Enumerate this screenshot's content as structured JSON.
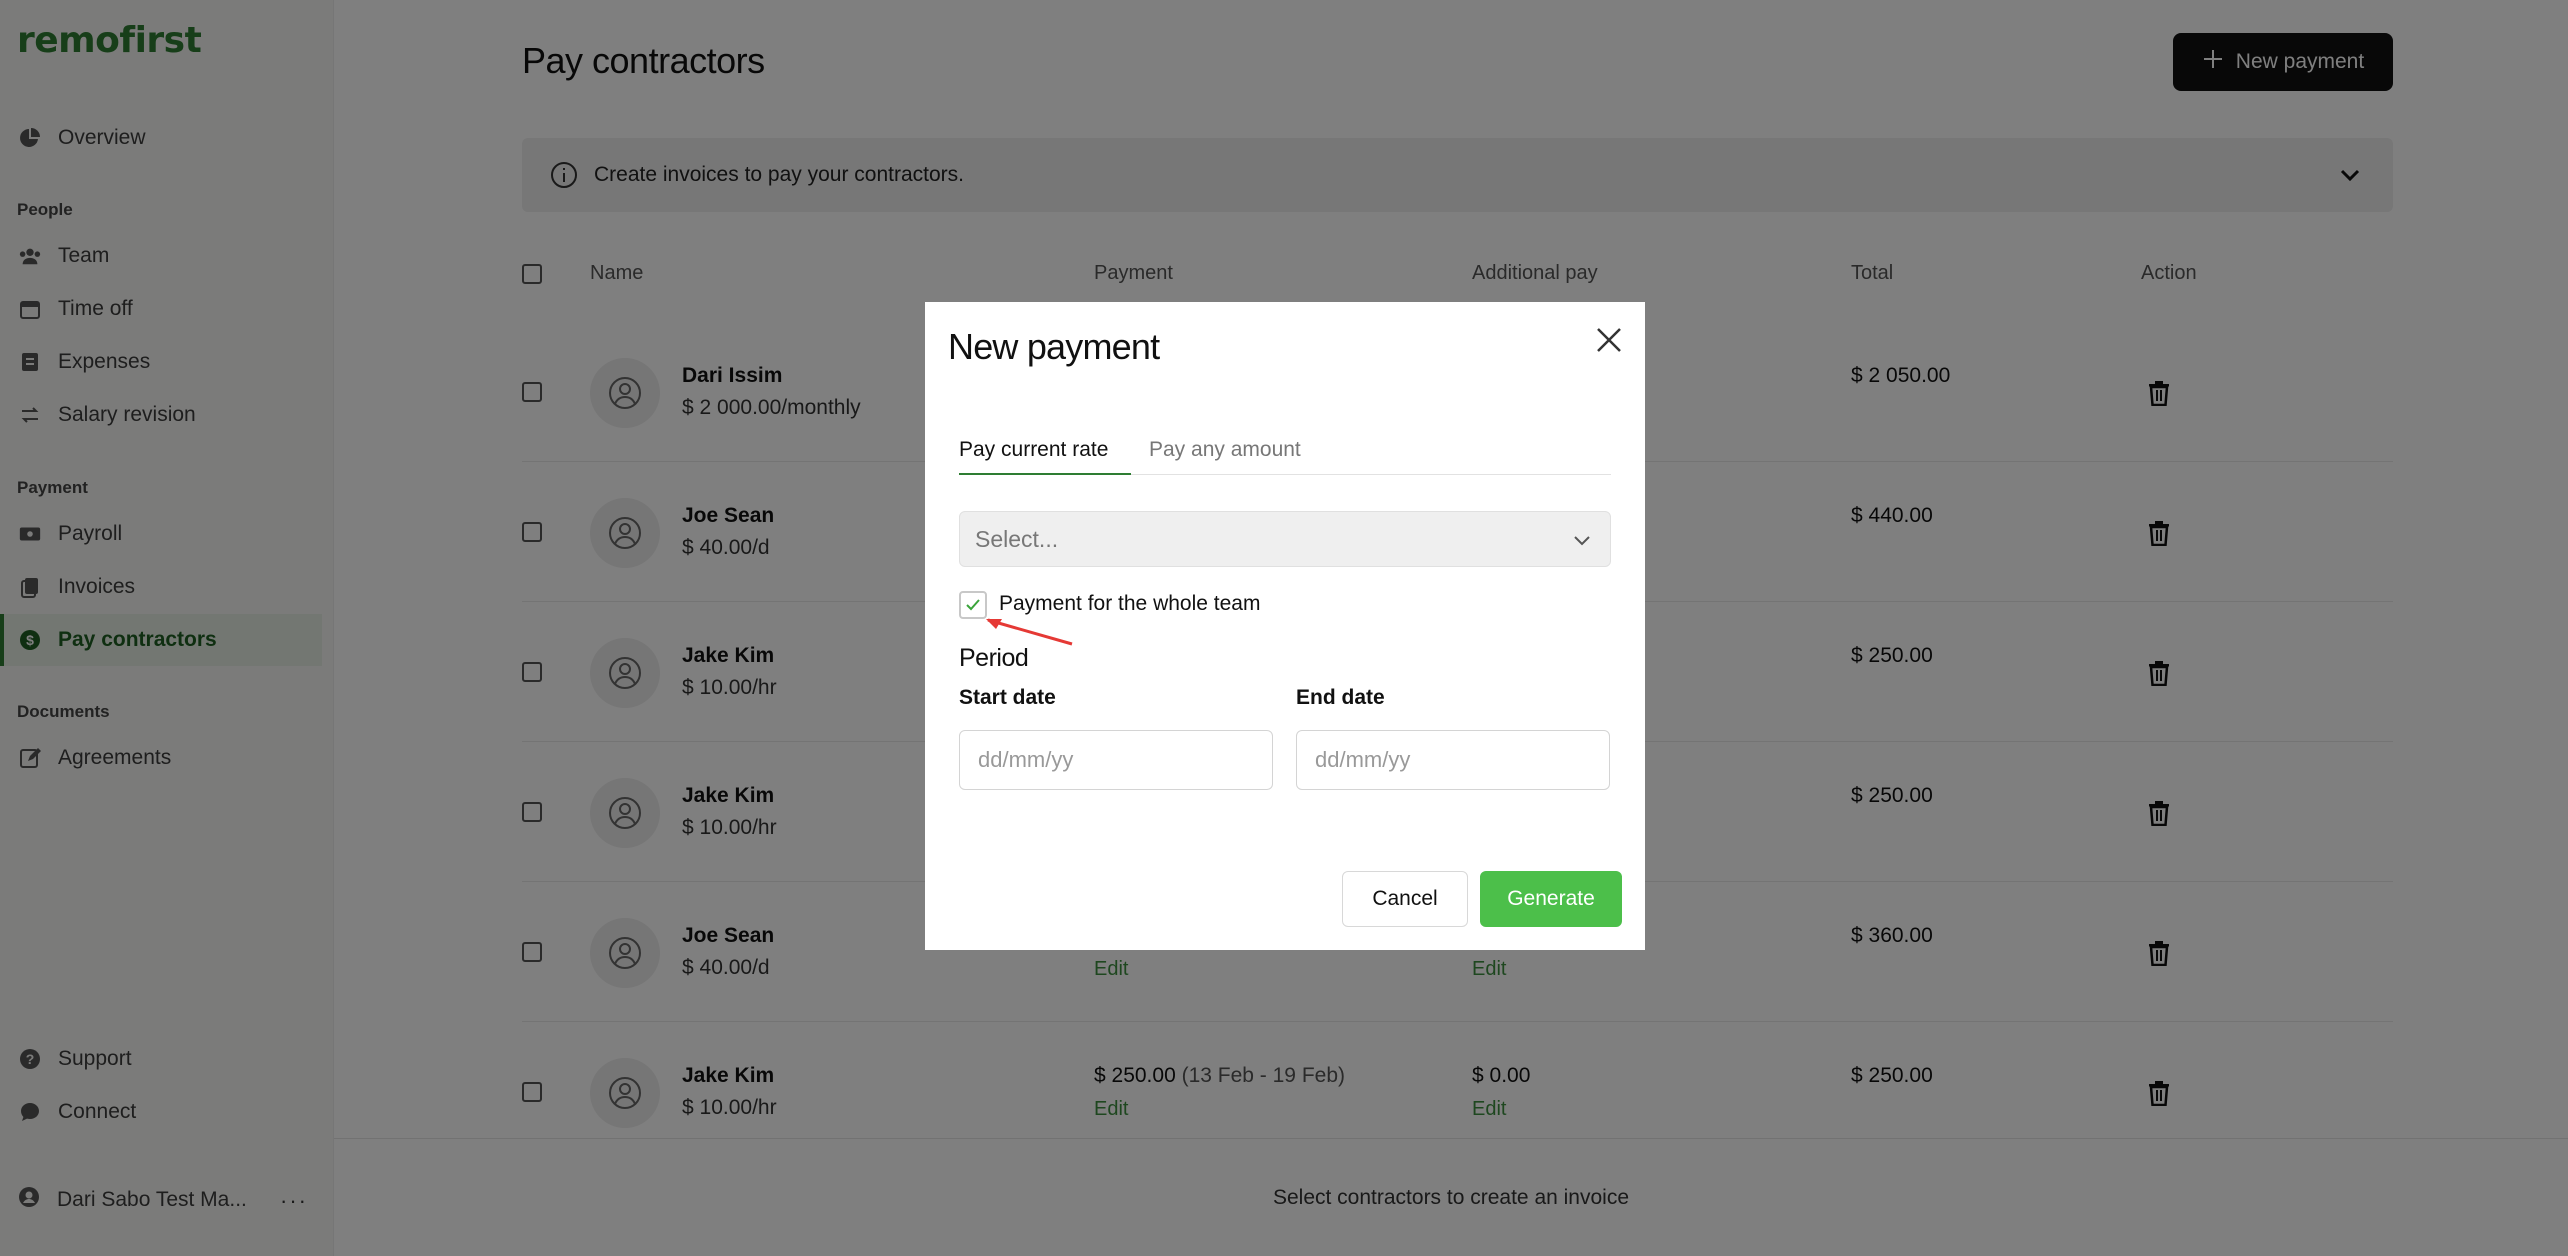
{
  "app": {
    "logo": "remofirst"
  },
  "sidebar": {
    "overview": "Overview",
    "sections": {
      "people": "People",
      "payment": "Payment",
      "documents": "Documents"
    },
    "people_items": [
      "Team",
      "Time off",
      "Expenses",
      "Salary revision"
    ],
    "payment_items": [
      "Payroll",
      "Invoices",
      "Pay contractors"
    ],
    "documents_items": [
      "Agreements"
    ],
    "bottom_items": [
      "Support",
      "Connect"
    ],
    "user": "Dari Sabo Test Ma...",
    "user_more": "···"
  },
  "header": {
    "title": "Pay contractors",
    "new_payment_label": "New payment",
    "banner_text": "Create invoices to pay your contractors."
  },
  "table": {
    "columns": [
      "Name",
      "Payment",
      "Additional pay",
      "Total",
      "Action"
    ],
    "edit_label": "Edit",
    "rows": [
      {
        "name": "Dari Issim",
        "rate": "$ 2 000.00/monthly",
        "payment": "",
        "period": "",
        "additional": "",
        "total": "$ 2 050.00"
      },
      {
        "name": "Joe Sean",
        "rate": "$ 40.00/d",
        "payment": "",
        "period": "",
        "additional": "",
        "total": "$ 440.00"
      },
      {
        "name": "Jake Kim",
        "rate": "$ 10.00/hr",
        "payment": "",
        "period": "",
        "additional": "",
        "total": "$ 250.00"
      },
      {
        "name": "Jake Kim",
        "rate": "$ 10.00/hr",
        "payment": "",
        "period": "",
        "additional": "",
        "total": "$ 250.00"
      },
      {
        "name": "Joe Sean",
        "rate": "$ 40.00/d",
        "payment": "",
        "period": "",
        "additional": "",
        "total": "$ 360.00"
      },
      {
        "name": "Jake Kim",
        "rate": "$ 10.00/hr",
        "payment": "$ 250.00",
        "period": "(13 Feb - 19 Feb)",
        "additional": "$ 0.00",
        "total": "$ 250.00"
      }
    ]
  },
  "footer": {
    "hint": "Select contractors to create an invoice"
  },
  "modal": {
    "title": "New payment",
    "tabs": [
      "Pay current rate",
      "Pay any amount"
    ],
    "select_placeholder": "Select...",
    "whole_team_label": "Payment for the whole team",
    "whole_team_checked": true,
    "period_label": "Period",
    "start_label": "Start date",
    "end_label": "End date",
    "start_placeholder": "dd/mm/yy",
    "end_placeholder": "dd/mm/yy",
    "cancel_label": "Cancel",
    "generate_label": "Generate"
  },
  "colors": {
    "brand": "#2e7d32",
    "generate": "#4cbf4a",
    "overlay": "rgba(0,0,0,0.5)",
    "annotation_arrow": "#e53935"
  }
}
